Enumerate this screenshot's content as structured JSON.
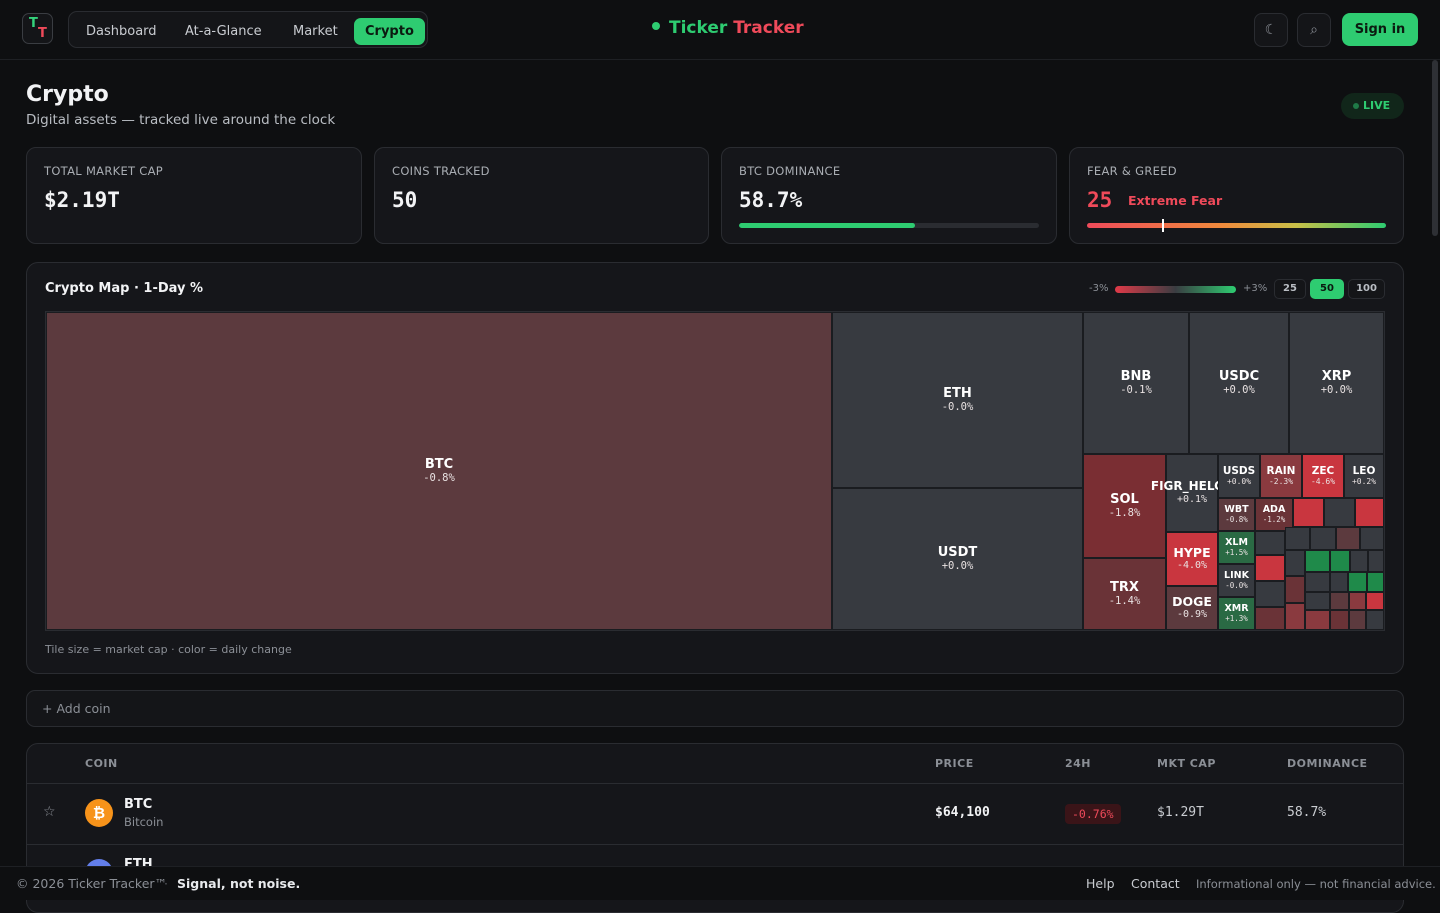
{
  "app": {
    "logo_t1": "T",
    "logo_t2": "T",
    "brand_a": "Ticker",
    "brand_b": "Tracker"
  },
  "nav": {
    "tabs": [
      "Dashboard",
      "At-a-Glance",
      "Market",
      "Crypto"
    ],
    "active": "Crypto"
  },
  "toolbar": {
    "theme_icon": "moon-icon",
    "search_icon": "search-icon",
    "theme_glyph": "☾",
    "search_glyph": "⌕",
    "signin_label": "Sign in"
  },
  "header": {
    "title": "Crypto",
    "subtitle": "Digital assets — tracked live around the clock",
    "live_label": "LIVE"
  },
  "stats": {
    "total_mcap_label": "TOTAL MARKET CAP",
    "total_mcap_value": "$2.19T",
    "coins_label": "COINS TRACKED",
    "coins_value": "50",
    "dominance_label": "BTC DOMINANCE",
    "dominance_value": "58.7%",
    "dominance_fraction": 0.587,
    "fg_label": "FEAR & GREED",
    "fg_value": "25",
    "fg_text": "Extreme Fear",
    "fg_fraction": 0.25
  },
  "map": {
    "title": "Crypto Map · 1-Day %",
    "legend_min": "-3%",
    "legend_max": "+3%",
    "sizes": [
      "25",
      "50",
      "100"
    ],
    "active_size": "50",
    "note": "Tile size = market cap · color = daily change",
    "tiles": [
      {
        "s": "BTC",
        "c": "-0.8%"
      },
      {
        "s": "ETH",
        "c": "-0.0%"
      },
      {
        "s": "USDT",
        "c": "+0.0%"
      },
      {
        "s": "BNB",
        "c": "-0.1%"
      },
      {
        "s": "USDC",
        "c": "+0.0%"
      },
      {
        "s": "XRP",
        "c": "+0.0%"
      },
      {
        "s": "SOL",
        "c": "-1.8%"
      },
      {
        "s": "TRX",
        "c": "-1.4%"
      },
      {
        "s": "FIGR_HELOC",
        "c": "+0.1%"
      },
      {
        "s": "HYPE",
        "c": "-4.0%"
      },
      {
        "s": "DOGE",
        "c": "-0.9%"
      },
      {
        "s": "USDS",
        "c": "+0.0%"
      },
      {
        "s": "RAIN",
        "c": "-2.3%"
      },
      {
        "s": "ZEC",
        "c": "-4.6%"
      },
      {
        "s": "LEO",
        "c": "+0.2%"
      },
      {
        "s": "WBT",
        "c": "-0.8%"
      },
      {
        "s": "ADA",
        "c": "-1.2%"
      },
      {
        "s": "XLM",
        "c": "+1.5%"
      },
      {
        "s": "LINK",
        "c": "-0.0%"
      },
      {
        "s": "XMR",
        "c": "+1.3%"
      }
    ],
    "colors": {
      "dark_red": "#5c3a3e",
      "mid_red": "#8a3a3f",
      "red": "#c9363f",
      "neutral": "#373a40",
      "green": "#1f8a4a",
      "dark_green": "#2a5a40"
    }
  },
  "add_coin": "+ Add coin",
  "table": {
    "headers": [
      "COIN",
      "PRICE",
      "24H",
      "MKT CAP",
      "DOMINANCE"
    ],
    "rows": [
      {
        "symbol": "BTC",
        "name": "Bitcoin",
        "icon_glyph": "₿",
        "price": "$64,100",
        "change": "-0.76%",
        "mcap": "$1.29T",
        "dominance": "58.7%"
      },
      {
        "symbol": "ETH"
      }
    ],
    "star_glyph": "☆"
  },
  "footer": {
    "copyright": "© 2026 Ticker Tracker™",
    "sep": "·",
    "tagline": "Signal, not noise.",
    "help": "Help",
    "contact": "Contact",
    "disclaimer": "Informational only — not financial advice."
  }
}
